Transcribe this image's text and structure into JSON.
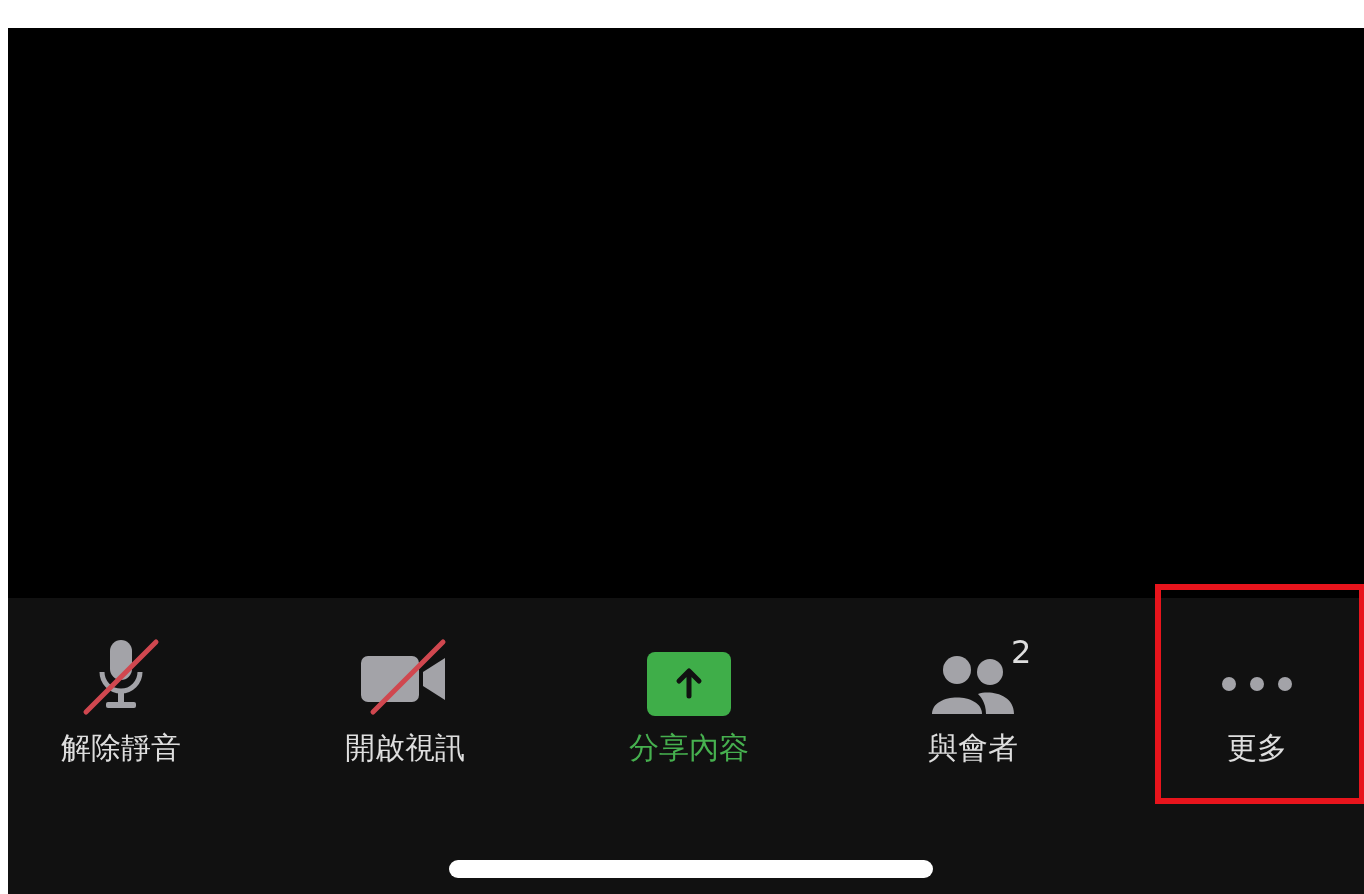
{
  "toolbar": {
    "items": [
      {
        "kind": "mic",
        "label": "解除靜音",
        "off": true,
        "active": false,
        "highlighted": false
      },
      {
        "kind": "video",
        "label": "開啟視訊",
        "off": true,
        "active": false,
        "highlighted": false
      },
      {
        "kind": "share",
        "label": "分享內容",
        "off": false,
        "active": true,
        "highlighted": false
      },
      {
        "kind": "participants",
        "label": "與會者",
        "badge": "2",
        "off": false,
        "active": false,
        "highlighted": false
      },
      {
        "kind": "more",
        "label": "更多",
        "off": false,
        "active": false,
        "highlighted": true
      }
    ]
  }
}
